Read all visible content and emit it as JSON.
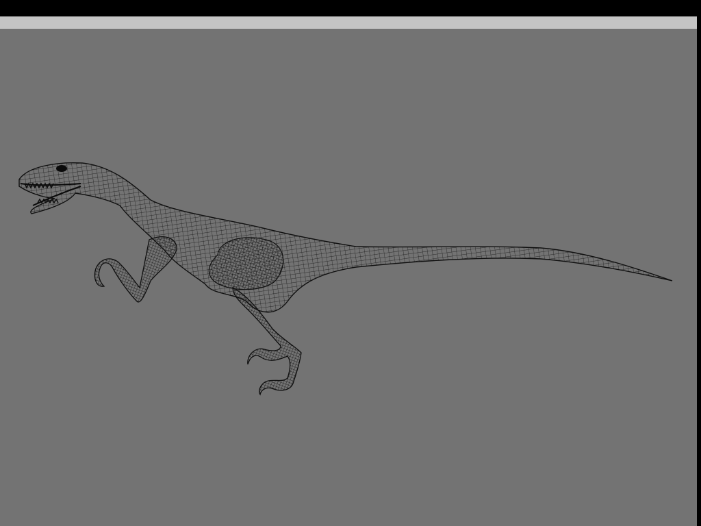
{
  "colors": {
    "frame": "#000000",
    "header_bar": "#c4c4c4",
    "viewport_background": "#737373",
    "wireframe": "#111111"
  },
  "viewport": {
    "display_mode": "wireframe",
    "model": "raptor-dinosaur-mesh"
  }
}
